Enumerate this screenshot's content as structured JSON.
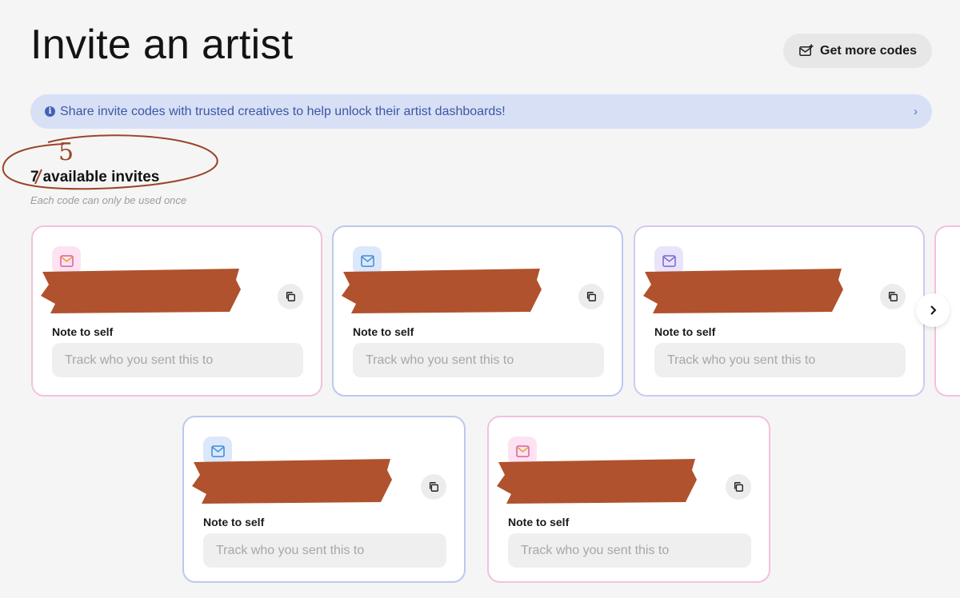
{
  "page": {
    "title": "Invite an artist"
  },
  "header": {
    "more_codes_label": "Get more codes",
    "more_codes_icon": "ticket-plus-icon"
  },
  "banner": {
    "text": "Share invite codes with trusted creatives to help unlock their artist dashboards!",
    "icon": "info-icon",
    "chevron": "›"
  },
  "invites": {
    "count": "7",
    "label": "available invites",
    "subtitle": "Each code can only be used once",
    "handwritten_correction": "5"
  },
  "cards": [
    {
      "note_label": "Note to self",
      "note_placeholder": "Track who you sent this to",
      "theme": "pink"
    },
    {
      "note_label": "Note to self",
      "note_placeholder": "Track who you sent this to",
      "theme": "blue"
    },
    {
      "note_label": "Note to self",
      "note_placeholder": "Track who you sent this to",
      "theme": "purple"
    },
    {
      "note_label": "Note to self",
      "note_placeholder": "Track who you sent this to",
      "theme": "blue"
    },
    {
      "note_label": "Note to self",
      "note_placeholder": "Track who you sent this to",
      "theme": "pink"
    }
  ],
  "colors": {
    "accent_banner": "#d8e0f6",
    "banner_text": "#3c57a3",
    "redaction": "#b0522e",
    "card_pink": "#f3c1de",
    "card_blue": "#bcc8ef"
  }
}
